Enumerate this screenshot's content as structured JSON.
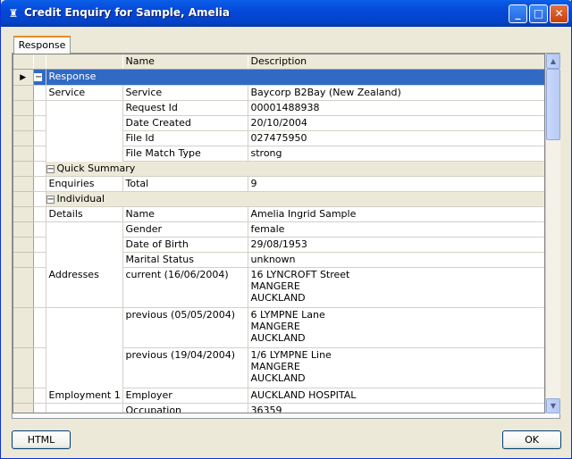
{
  "window": {
    "title": "Credit Enquiry for Sample, Amelia",
    "minimize_glyph": "_",
    "maximize_glyph": "□",
    "close_glyph": "✕"
  },
  "tab": {
    "label": "Response"
  },
  "grid": {
    "headers": {
      "name": "Name",
      "description": "Description"
    },
    "rows": [
      {
        "kind": "group",
        "label": "Response",
        "selected": true,
        "indicator": "▶",
        "toggle": "−"
      },
      {
        "kind": "data",
        "section": "Service",
        "name": "Service",
        "value": [
          "Baycorp B2Bay (New Zealand)"
        ]
      },
      {
        "kind": "data",
        "section": "",
        "name": "Request Id",
        "value": [
          "00001488938"
        ]
      },
      {
        "kind": "data",
        "section": "",
        "name": "Date Created",
        "value": [
          "20/10/2004"
        ]
      },
      {
        "kind": "data",
        "section": "",
        "name": "File Id",
        "value": [
          "027475950"
        ]
      },
      {
        "kind": "data",
        "section": "",
        "name": "File Match Type",
        "value": [
          "strong"
        ]
      },
      {
        "kind": "group",
        "label": "Quick Summary",
        "selected": false,
        "toggle": "−"
      },
      {
        "kind": "data",
        "section": "Enquiries",
        "name": "Total",
        "value": [
          "9"
        ]
      },
      {
        "kind": "group",
        "label": "Individual",
        "selected": false,
        "toggle": "−"
      },
      {
        "kind": "data",
        "section": "Details",
        "name": "Name",
        "value": [
          "Amelia Ingrid Sample"
        ]
      },
      {
        "kind": "data",
        "section": "",
        "name": "Gender",
        "value": [
          "female"
        ]
      },
      {
        "kind": "data",
        "section": "",
        "name": "Date of Birth",
        "value": [
          "29/08/1953"
        ]
      },
      {
        "kind": "data",
        "section": "",
        "name": "Marital Status",
        "value": [
          "unknown"
        ]
      },
      {
        "kind": "data",
        "section": "Addresses",
        "name": "current (16/06/2004)",
        "value": [
          "16 LYNCROFT Street",
          "MANGERE",
          "AUCKLAND"
        ]
      },
      {
        "kind": "data",
        "section": "",
        "name": "previous (05/05/2004)",
        "value": [
          "6 LYMPNE Lane",
          "MANGERE",
          "AUCKLAND"
        ]
      },
      {
        "kind": "data",
        "section": "",
        "name": "previous (19/04/2004)",
        "value": [
          "1/6 LYMPNE Line",
          "MANGERE",
          "AUCKLAND"
        ]
      },
      {
        "kind": "data",
        "section": "Employment 1",
        "name": "Employer",
        "value": [
          "AUCKLAND HOSPITAL"
        ]
      },
      {
        "kind": "data",
        "section": "",
        "name": "Occupation",
        "value": [
          "36359"
        ]
      }
    ]
  },
  "scrollbar": {
    "up_glyph": "▲",
    "down_glyph": "▼"
  },
  "buttons": {
    "html": "HTML",
    "ok": "OK"
  }
}
